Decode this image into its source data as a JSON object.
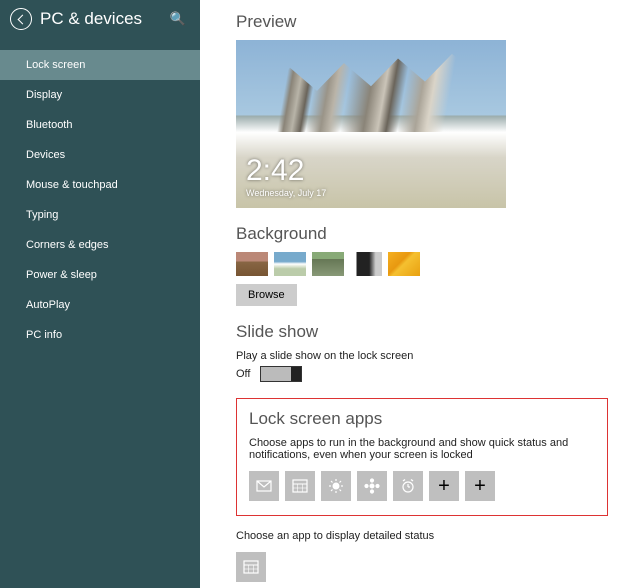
{
  "sidebar": {
    "title": "PC & devices",
    "items": [
      {
        "label": "Lock screen",
        "active": true
      },
      {
        "label": "Display"
      },
      {
        "label": "Bluetooth"
      },
      {
        "label": "Devices"
      },
      {
        "label": "Mouse & touchpad"
      },
      {
        "label": "Typing"
      },
      {
        "label": "Corners & edges"
      },
      {
        "label": "Power & sleep"
      },
      {
        "label": "AutoPlay"
      },
      {
        "label": "PC info"
      }
    ]
  },
  "preview": {
    "heading": "Preview",
    "time": "2:42",
    "date": "Wednesday, July 17"
  },
  "background": {
    "heading": "Background",
    "browse": "Browse"
  },
  "slideshow": {
    "heading": "Slide show",
    "text": "Play a slide show on the lock screen",
    "toggle_state": "Off"
  },
  "lockapps": {
    "heading": "Lock screen apps",
    "text": "Choose apps to run in the background and show quick status and notifications, even when your screen is locked",
    "slots": [
      "mail",
      "calendar",
      "weather",
      "people",
      "alarm",
      "add",
      "add"
    ]
  },
  "detail": {
    "text": "Choose an app to display detailed status",
    "slot": "calendar"
  }
}
